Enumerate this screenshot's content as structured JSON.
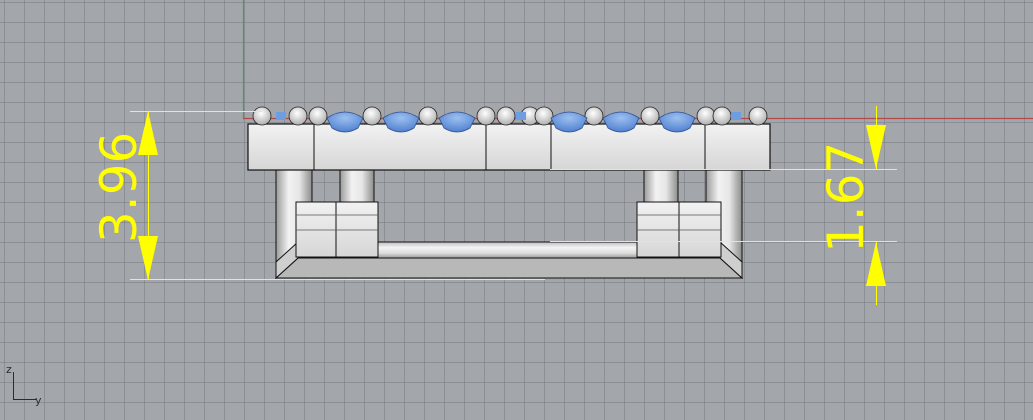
{
  "viewport": {
    "background_color": "#a3a6ab",
    "grid_color": "#7e8288",
    "world_axis_x_color": "#b24a4a",
    "world_axis_y_color": "#3fa63f"
  },
  "dimensions": {
    "overall_height": "3.96",
    "lower_height": "1.67",
    "dimension_color": "#ffff00"
  },
  "axis_indicator": {
    "up_label": "z",
    "right_label": "y"
  },
  "model": {
    "body_color": "#e8e8e8",
    "edge_color": "#111111",
    "gem_color": "#6f9ee0"
  }
}
